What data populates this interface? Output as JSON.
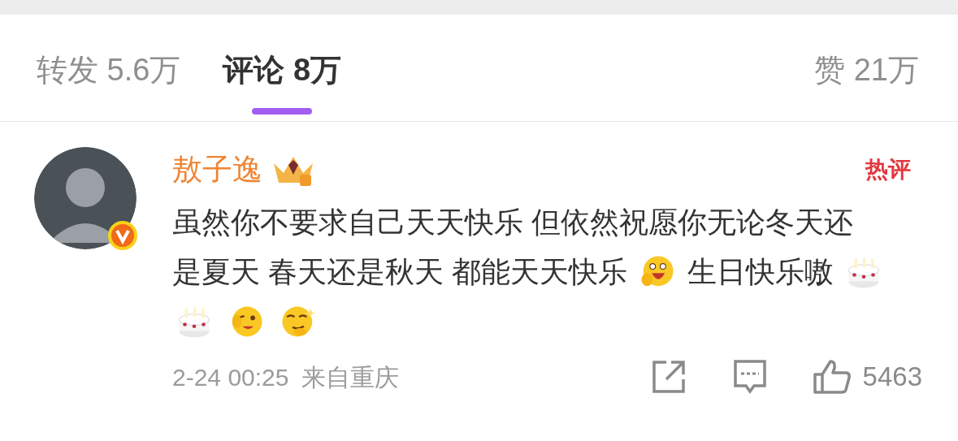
{
  "tabs": [
    {
      "label": "转发 5.6万",
      "selected": false
    },
    {
      "label": "评论 8万",
      "selected": true
    }
  ],
  "likes_tab": {
    "label": "赞 21万"
  },
  "comment": {
    "author": "敖子逸",
    "verified": true,
    "hot_badge": "热评",
    "lines": [
      [
        {
          "kind": "text",
          "text": "虽然你不要求自己天天快乐 但依然祝愿你无论冬天还"
        }
      ],
      [
        {
          "kind": "text",
          "text": "是夏天 春天还是秋天 都能天天快乐"
        },
        {
          "kind": "grin"
        },
        {
          "kind": "text",
          "text": "生日快乐嗷"
        },
        {
          "kind": "cake"
        }
      ],
      [
        {
          "kind": "cake"
        },
        {
          "kind": "wink"
        },
        {
          "kind": "smirk"
        }
      ]
    ],
    "time": "2-24 00:25",
    "location": "来自重庆",
    "like_count": "5463"
  }
}
